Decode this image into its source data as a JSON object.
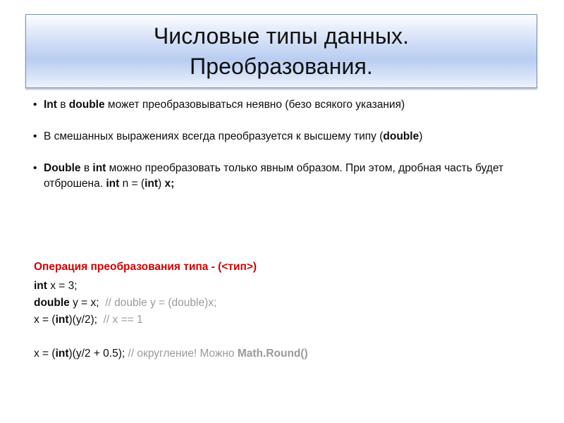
{
  "slide": {
    "title_lines": [
      "Числовые типы данных.",
      "Преобразования."
    ],
    "bullet_marker": "•",
    "bullets": [
      {
        "parts": [
          {
            "text": "Int",
            "bold": true
          },
          {
            "text": " в ",
            "bold": false
          },
          {
            "text": "double",
            "bold": true
          },
          {
            "text": " может преобразовываться неявно (безо всякого указания)",
            "bold": false
          }
        ]
      },
      {
        "parts": [
          {
            "text": "В смешанных выражениях всегда преобразуется к высшему типу (",
            "bold": false
          },
          {
            "text": "double",
            "bold": true
          },
          {
            "text": ")",
            "bold": false
          }
        ]
      },
      {
        "parts": [
          {
            "text": "Double",
            "bold": true
          },
          {
            "text": " в ",
            "bold": false
          },
          {
            "text": "int",
            "bold": true
          },
          {
            "text": " можно преобразовать только явным образом. При этом, дробная часть будет отброшена.  ",
            "bold": false
          },
          {
            "text": "int",
            "bold": true
          },
          {
            "text": " n = (",
            "bold": false
          },
          {
            "text": "int",
            "bold": true
          },
          {
            "text": ") ",
            "bold": false
          },
          {
            "text": "x;",
            "bold": true
          }
        ]
      }
    ],
    "code": {
      "heading": "Операция преобразования типа - (<тип>)",
      "heading_color": "#d30003",
      "comment_color": "#9a9a9a",
      "lines": [
        {
          "spacer_before": false,
          "parts": [
            {
              "text": "int",
              "style": "bold"
            },
            {
              "text": " x = 3;",
              "style": "normal"
            }
          ]
        },
        {
          "spacer_before": false,
          "parts": [
            {
              "text": "double",
              "style": "bold"
            },
            {
              "text": " y = x;  ",
              "style": "normal"
            },
            {
              "text": "// double y = (double)x;",
              "style": "comment"
            }
          ]
        },
        {
          "spacer_before": false,
          "parts": [
            {
              "text": "x = (",
              "style": "normal"
            },
            {
              "text": "int",
              "style": "bold"
            },
            {
              "text": ")(y/2);  ",
              "style": "normal"
            },
            {
              "text": "// x == 1",
              "style": "comment"
            }
          ]
        },
        {
          "spacer_before": true,
          "parts": [
            {
              "text": "x = (",
              "style": "normal"
            },
            {
              "text": "int",
              "style": "bold"
            },
            {
              "text": ")(y/2 + 0.5); ",
              "style": "normal"
            },
            {
              "text": "// округление! Можно ",
              "style": "comment"
            },
            {
              "text": "Math.Round()",
              "style": "comment-bold"
            }
          ]
        }
      ]
    }
  }
}
